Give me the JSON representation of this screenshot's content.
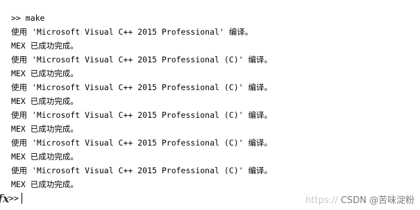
{
  "console": {
    "lines": [
      ">> make",
      "使用 'Microsoft Visual C++ 2015 Professional' 编译。",
      "MEX 已成功完成。",
      "使用 'Microsoft Visual C++ 2015 Professional (C)' 编译。",
      "MEX 已成功完成。",
      "使用 'Microsoft Visual C++ 2015 Professional (C)' 编译。",
      "MEX 已成功完成。",
      "使用 'Microsoft Visual C++ 2015 Professional (C)' 编译。",
      "MEX 已成功完成。",
      "使用 'Microsoft Visual C++ 2015 Professional (C)' 编译。",
      "MEX 已成功完成。",
      "使用 'Microsoft Visual C++ 2015 Professional (C)' 编译。",
      "MEX 已成功完成。"
    ],
    "fx_label": "fx",
    "prompt": ">>"
  },
  "watermark": {
    "url_text": "https://",
    "text": "CSDN @苦味淀粉"
  }
}
